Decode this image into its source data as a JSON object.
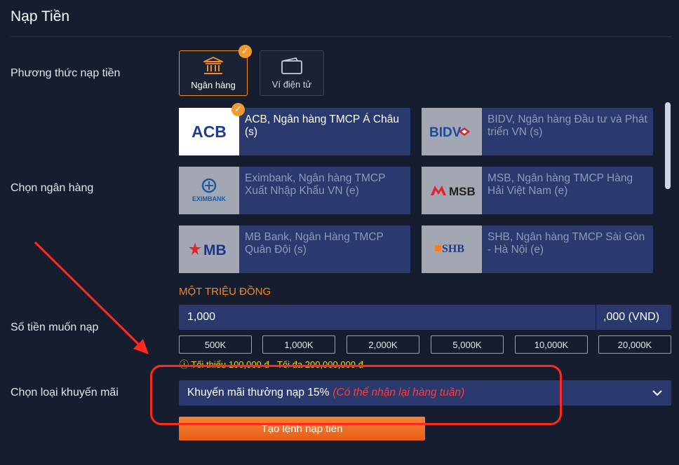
{
  "page": {
    "title": "Nạp Tiền"
  },
  "labels": {
    "method": "Phương thức nạp tiền",
    "bank": "Chọn ngân hàng",
    "amount": "Số tiền muốn nạp",
    "promo": "Chọn loại khuyến mãi"
  },
  "methods": [
    {
      "label": "Ngân hàng",
      "selected": true,
      "icon": "bank-icon"
    },
    {
      "label": "Ví điện tử",
      "selected": false,
      "icon": "wallet-icon"
    }
  ],
  "banks": [
    {
      "logo": "ACB",
      "name": "ACB, Ngân hàng TMCP Á Châu (s)",
      "selected": true
    },
    {
      "logo": "BIDV",
      "name": "BIDV, Ngân hàng Đầu tư và Phát triển VN (s)",
      "selected": false
    },
    {
      "logo": "EXIMBANK",
      "name": "Eximbank, Ngân hàng TMCP Xuất Nhập Khẩu VN (e)",
      "selected": false
    },
    {
      "logo": "MSB",
      "name": "MSB, Ngân hàng TMCP Hàng Hải Việt Nam (e)",
      "selected": false
    },
    {
      "logo": "MB",
      "name": "MB Bank, Ngân Hàng TMCP Quân Đội (s)",
      "selected": false
    },
    {
      "logo": "SHB",
      "name": "SHB, Ngân hàng TMCP Sài Gòn - Hà Nội (e)",
      "selected": false
    }
  ],
  "amount": {
    "in_words": "MỘT TRIỆU ĐỒNG",
    "value": "1,000",
    "unit": ",000 (VND)",
    "quick_options": [
      "500K",
      "1,000K",
      "2,000K",
      "5,000K",
      "10,000K",
      "20,000K"
    ],
    "limit_text": "ⓘ Tối thiểu 100,000 đ - Tối đa 200,000,000 đ"
  },
  "promo": {
    "selected": "Khuyến mãi thưởng nạp 15%",
    "note": "(Có thể nhận lại hàng tuần)"
  },
  "submit_label": "Tạo lệnh nạp tiền",
  "colors": {
    "background": "#151d2e",
    "card": "#2a3a6e",
    "accent": "#f28a28",
    "annotation": "#ff2a1c"
  }
}
